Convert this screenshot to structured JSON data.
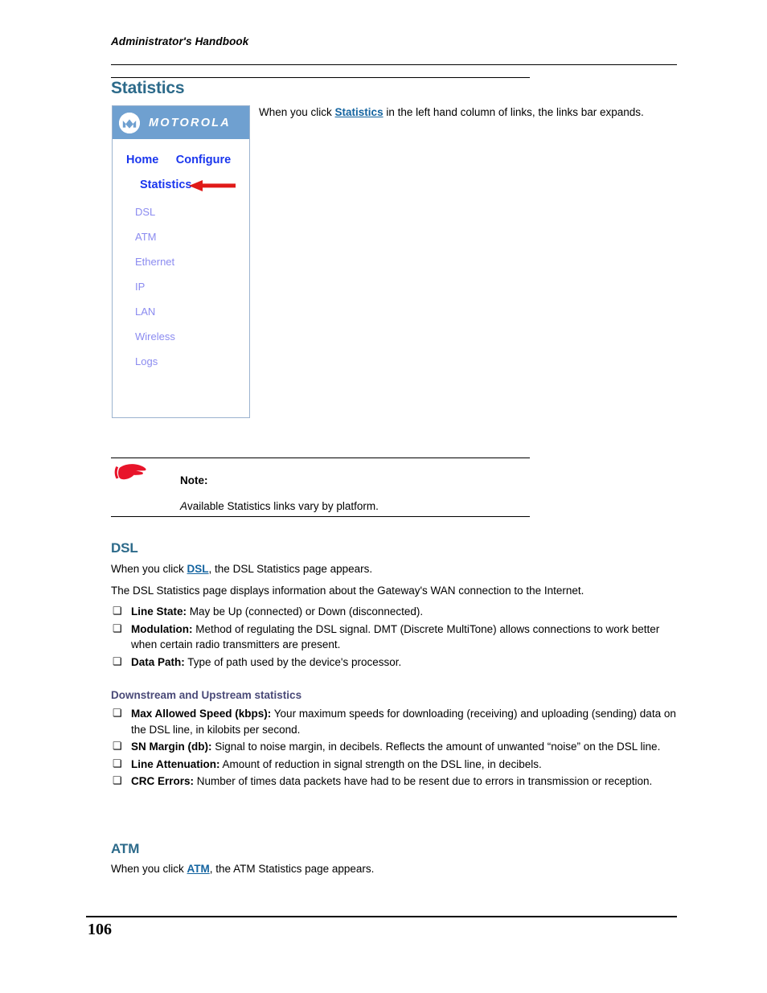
{
  "header": {
    "running_head": "Administrator's Handbook"
  },
  "chapter": {
    "title": "Statistics"
  },
  "screenshot": {
    "brand": {
      "logo_icon": "motorola-m-logo-icon",
      "wordmark": "MOTOROLA"
    },
    "main_links": [
      {
        "label": "Home"
      },
      {
        "label": "Configure"
      },
      {
        "label": "Statistics"
      }
    ],
    "sub_links": [
      {
        "label": "DSL"
      },
      {
        "label": "ATM"
      },
      {
        "label": "Ethernet"
      },
      {
        "label": "IP"
      },
      {
        "label": "LAN"
      },
      {
        "label": "Wireless"
      },
      {
        "label": "Logs"
      }
    ],
    "annotation": {
      "icon": "red-left-arrow-icon",
      "points_to": "Statistics"
    },
    "colors": {
      "header_bg": "#6fa0d0",
      "main_link": "#1a36ee",
      "sub_link": "#8b8bf0",
      "border": "#9bb3cf",
      "arrow": "#e01a18"
    }
  },
  "intro": {
    "before_link": "When you click ",
    "link": "Statistics",
    "after_link": " in the left hand column of links, the links bar expands."
  },
  "note": {
    "icon": "pointing-hand-icon",
    "label": "Note:",
    "text_italic_lead": "A",
    "text": "vailable Statistics links vary by platform."
  },
  "sections": [
    {
      "id": "dsl",
      "heading": "DSL",
      "intro_before": "When you click ",
      "intro_link": "DSL",
      "intro_after": ", the DSL Statistics page appears.",
      "para": "The DSL Statistics page displays information about the Gateway's WAN connection to the Internet.",
      "bullets": [
        {
          "term": "Line State:",
          "desc": " May be Up (connected) or Down (disconnected)."
        },
        {
          "term": "Modulation:",
          "desc": " Method of regulating the DSL signal. DMT (Discrete MultiTone) allows connections to work better when certain radio transmitters are present."
        },
        {
          "term": "Data Path:",
          "desc": " Type of path used by the device's processor."
        }
      ],
      "subheading": "Downstream and Upstream statistics",
      "sub_bullets": [
        {
          "term": "Max Allowed Speed (kbps):",
          "desc": " Your maximum speeds for downloading (receiving) and uploading (sending) data on the DSL line, in kilobits per second."
        },
        {
          "term": "SN Margin (db):",
          "desc": " Signal to noise margin, in decibels. Reflects the amount of unwanted “noise” on the DSL line."
        },
        {
          "term": "Line Attenuation:",
          "desc": " Amount of reduction in signal strength on the DSL line, in decibels."
        },
        {
          "term": "CRC Errors:",
          "desc": " Number of times data packets have had to be resent due to errors in transmission or reception."
        }
      ]
    },
    {
      "id": "atm",
      "heading": "ATM",
      "intro_before": "When you click ",
      "intro_link": "ATM",
      "intro_after": ", the ATM Statistics page appears."
    }
  ],
  "footer": {
    "page_number": "106"
  },
  "theme": {
    "heading_color": "#2c6a8a",
    "link_color": "#1464a0",
    "subheading_color": "#4a4a78"
  }
}
